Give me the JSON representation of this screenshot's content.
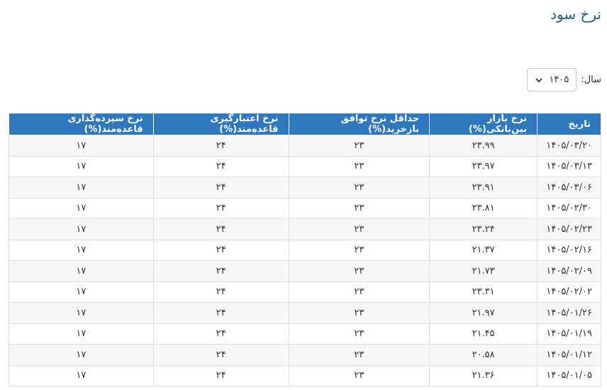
{
  "page": {
    "title": "نرخ سود"
  },
  "filter": {
    "year_label": "سال:",
    "year_value": "۱۴۰۵"
  },
  "table": {
    "columns": [
      "تاریخ",
      "نرخ بازار بین‌بانکی(%)",
      "حداقل نرخ توافق بازخرید(%)",
      "نرخ اعتبارگیری قاعده‌مند(%)",
      "نرخ سپرده‌گذاری قاعده‌مند(%)"
    ],
    "rows": [
      [
        "۱۴۰۵/۰۳/۲۰",
        "۲۳.۹۹",
        "۲۳",
        "۲۴",
        "۱۷"
      ],
      [
        "۱۴۰۵/۰۳/۱۳",
        "۲۳.۹۷",
        "۲۳",
        "۲۴",
        "۱۷"
      ],
      [
        "۱۴۰۵/۰۳/۰۶",
        "۲۳.۹۱",
        "۲۳",
        "۲۴",
        "۱۷"
      ],
      [
        "۱۴۰۵/۰۲/۳۰",
        "۲۳.۸۱",
        "۲۳",
        "۲۴",
        "۱۷"
      ],
      [
        "۱۴۰۵/۰۲/۲۳",
        "۲۳.۲۴",
        "۲۳",
        "۲۴",
        "۱۷"
      ],
      [
        "۱۴۰۵/۰۲/۱۶",
        "۲۱.۳۷",
        "۲۳",
        "۲۴",
        "۱۷"
      ],
      [
        "۱۴۰۵/۰۲/۰۹",
        "۲۱.۷۳",
        "۲۳",
        "۲۴",
        "۱۷"
      ],
      [
        "۱۴۰۵/۰۲/۰۲",
        "۲۳.۳۱",
        "۲۳",
        "۲۴",
        "۱۷"
      ],
      [
        "۱۴۰۵/۰۱/۲۶",
        "۲۱.۹۷",
        "۲۳",
        "۲۴",
        "۱۷"
      ],
      [
        "۱۴۰۵/۰۱/۱۹",
        "۲۱.۴۵",
        "۲۳",
        "۲۴",
        "۱۷"
      ],
      [
        "۱۴۰۵/۰۱/۱۲",
        "۲۰.۵۸",
        "۲۳",
        "۲۴",
        "۱۷"
      ],
      [
        "۱۴۰۵/۰۱/۰۵",
        "۲۱.۳۶",
        "۲۳",
        "۲۴",
        "۱۷"
      ]
    ]
  },
  "colors": {
    "header_bg": "#2f78bd",
    "title": "#1f5a8c"
  }
}
